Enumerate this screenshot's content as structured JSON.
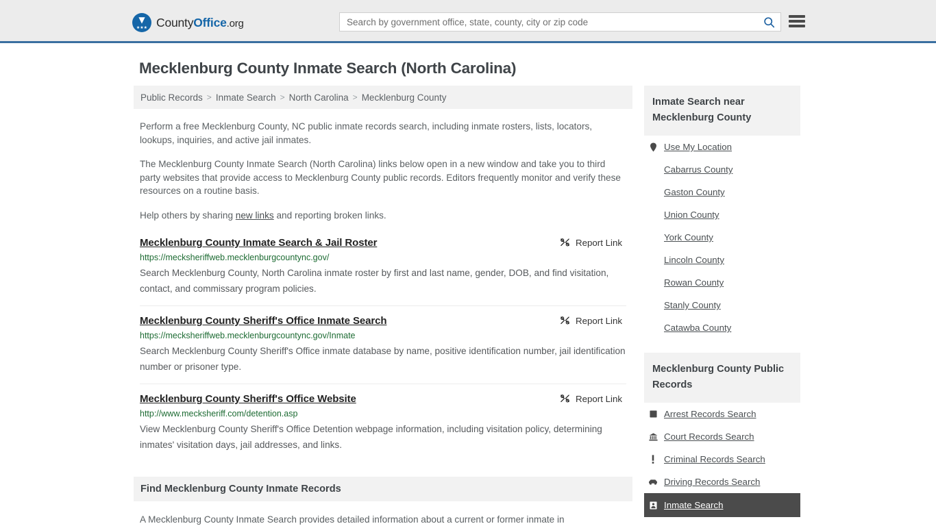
{
  "header": {
    "brand": {
      "part1": "County",
      "part2": "Office",
      "part3": ".org",
      "icon": "eagle-crest-logo"
    },
    "search": {
      "placeholder": "Search by government office, state, county, city or zip code",
      "value": "",
      "search_icon": "search-icon"
    },
    "menu_icon": "hamburger-menu-icon",
    "accent_color": "#3a6fa0",
    "background_color": "#ececec"
  },
  "page": {
    "title": "Mecklenburg County Inmate Search (North Carolina)",
    "breadcrumb": [
      "Public Records",
      "Inmate Search",
      "North Carolina",
      "Mecklenburg County"
    ],
    "breadcrumb_separator": ">"
  },
  "intro": {
    "p1": "Perform a free Mecklenburg County, NC public inmate records search, including inmate rosters, lists, locators, lookups, inquiries, and active jail inmates.",
    "p2": "The Mecklenburg County Inmate Search (North Carolina) links below open in a new window and take you to third party websites that provide access to Mecklenburg County public records. Editors frequently monitor and verify these resources on a routine basis.",
    "p3_before": "Help others by sharing ",
    "p3_link": "new links",
    "p3_after": " and reporting broken links."
  },
  "report_link_label": "Report Link",
  "report_link_icon": "broken-link-icon",
  "results": [
    {
      "title": "Mecklenburg County Inmate Search & Jail Roster",
      "url": "https://mecksheriffweb.mecklenburgcountync.gov/",
      "description": "Search Mecklenburg County, North Carolina inmate roster by first and last name, gender, DOB, and find visitation, contact, and commissary program policies."
    },
    {
      "title": "Mecklenburg County Sheriff's Office Inmate Search",
      "url": "https://mecksheriffweb.mecklenburgcountync.gov/Inmate",
      "description": "Search Mecklenburg County Sheriff's Office inmate database by name, positive identification number, jail identification number or prisoner type."
    },
    {
      "title": "Mecklenburg County Sheriff's Office Website",
      "url": "http://www.mecksheriff.com/detention.asp",
      "description": "View Mecklenburg County Sheriff's Office Detention webpage information, including visitation policy, determining inmates' visitation days, jail addresses, and links."
    }
  ],
  "bottom_section": {
    "heading": "Find Mecklenburg County Inmate Records",
    "paragraph": "A Mecklenburg County Inmate Search provides detailed information about a current or former inmate in"
  },
  "sidebar": {
    "nearby": {
      "heading": "Inmate Search near Mecklenburg County",
      "items": [
        {
          "label": "Use My Location",
          "icon": "map-pin-icon"
        },
        {
          "label": "Cabarrus County",
          "icon": ""
        },
        {
          "label": "Gaston County",
          "icon": ""
        },
        {
          "label": "Union County",
          "icon": ""
        },
        {
          "label": "York County",
          "icon": ""
        },
        {
          "label": "Lincoln County",
          "icon": ""
        },
        {
          "label": "Rowan County",
          "icon": ""
        },
        {
          "label": "Stanly County",
          "icon": ""
        },
        {
          "label": "Catawba County",
          "icon": ""
        }
      ]
    },
    "public_records": {
      "heading": "Mecklenburg County Public Records",
      "items": [
        {
          "label": "Arrest Records Search",
          "icon": "fingerprint-card-icon",
          "active": false
        },
        {
          "label": "Court Records Search",
          "icon": "courthouse-icon",
          "active": false
        },
        {
          "label": "Criminal Records Search",
          "icon": "exclamation-icon",
          "active": false
        },
        {
          "label": "Driving Records Search",
          "icon": "car-icon",
          "active": false
        },
        {
          "label": "Inmate Search",
          "icon": "inmate-card-icon",
          "active": true
        }
      ],
      "active_background": "#4b4b4b"
    }
  }
}
